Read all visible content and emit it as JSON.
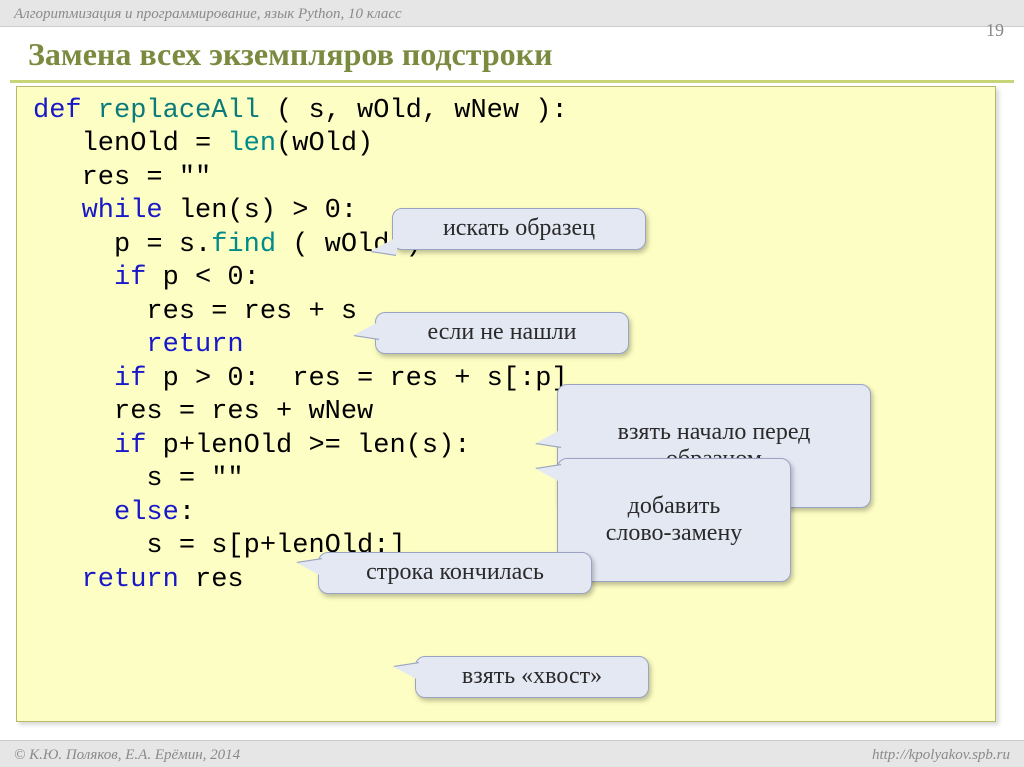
{
  "header": {
    "breadcrumb": "Алгоритмизация и программирование, язык Python, 10 класс",
    "page_number": "19"
  },
  "title": "Замена всех экземпляров подстроки",
  "code": {
    "l1_def": "def",
    "l1_name": " replaceAll ",
    "l1_args": "( s, wOld, wNew ):",
    "l2_a": "   lenOld = ",
    "l2_len": "len",
    "l2_b": "(wOld)",
    "l3": "   res = \"\"",
    "l4_while": "   while",
    "l4_rest": " len(s) > 0:",
    "l5_a": "     p = s.",
    "l5_find": "find",
    "l5_b": " ( wOld )",
    "l6_if": "     if",
    "l6_rest": " p < 0:",
    "l7": "       res = res + s",
    "l8_return": "       return",
    "l9_if": "     if",
    "l9_rest": " p > 0:  res = res + s[:p]",
    "l10": "     res = res + wNew",
    "l11_if": "     if",
    "l11_rest": " p+lenOld >= len(s):",
    "l12": "       s = \"\"",
    "l13_else": "     else",
    "l13_rest": ":",
    "l14": "       s = s[p+lenOld:]",
    "l15_return": "   return",
    "l15_rest": " res"
  },
  "callouts": {
    "c1": "искать образец",
    "c2": "если не нашли",
    "c3": "взять начало перед\nобразцом",
    "c4": "добавить\nслово-замену",
    "c5": "строка кончилась",
    "c6": "взять «хвост»"
  },
  "footer": {
    "left": "© К.Ю. Поляков, Е.А. Ерёмин, 2014",
    "right": "http://kpolyakov.spb.ru"
  }
}
